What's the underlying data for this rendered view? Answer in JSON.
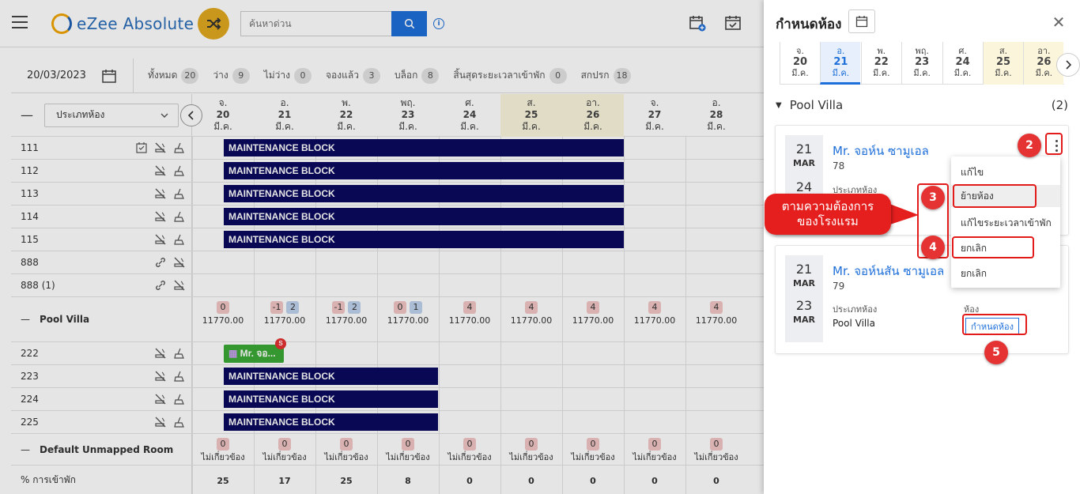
{
  "header": {
    "app_name": "eZee Absolute",
    "search_placeholder": "ค้นหาด่วน",
    "info_label": "i"
  },
  "toolbar": {
    "date": "20/03/2023",
    "stats": [
      {
        "label": "ทั้งหมด",
        "count": "20"
      },
      {
        "label": "ว่าง",
        "count": "9"
      },
      {
        "label": "ไม่ว่าง",
        "count": "0"
      },
      {
        "label": "จองแล้ว",
        "count": "3"
      },
      {
        "label": "บล็อก",
        "count": "8"
      },
      {
        "label": "สิ้นสุดระยะเวลาเข้าพัก",
        "count": "0"
      },
      {
        "label": "สกปรก",
        "count": "18"
      }
    ]
  },
  "grid": {
    "room_type_select": "ประเภทห้อง",
    "days": [
      {
        "dow": "จ.",
        "day": "20",
        "mon": "มี.ค."
      },
      {
        "dow": "อ.",
        "day": "21",
        "mon": "มี.ค."
      },
      {
        "dow": "พ.",
        "day": "22",
        "mon": "มี.ค."
      },
      {
        "dow": "พฤ.",
        "day": "23",
        "mon": "มี.ค."
      },
      {
        "dow": "ศ.",
        "day": "24",
        "mon": "มี.ค."
      },
      {
        "dow": "ส.",
        "day": "25",
        "mon": "มี.ค."
      },
      {
        "dow": "อา.",
        "day": "26",
        "mon": "มี.ค."
      },
      {
        "dow": "จ.",
        "day": "27",
        "mon": "มี.ค."
      },
      {
        "dow": "อ.",
        "day": "28",
        "mon": "มี.ค."
      }
    ],
    "rooms_top": [
      "111",
      "112",
      "113",
      "114",
      "115",
      "888",
      "888 (1)"
    ],
    "block_label": "MAINTENANCE BLOCK",
    "pool_villa": {
      "name": "Pool Villa",
      "avail": [
        [
          "0"
        ],
        [
          "-1",
          "2"
        ],
        [
          "-1",
          "2"
        ],
        [
          "0",
          "1"
        ],
        [
          "4"
        ],
        [
          "4"
        ],
        [
          "4"
        ],
        [
          "4"
        ],
        [
          "4"
        ]
      ],
      "price": "11770.00"
    },
    "rooms_pool": [
      "222",
      "223",
      "224",
      "225"
    ],
    "booking_chip": "Mr. จอ...",
    "booking_badge": "S",
    "unmapped": {
      "name": "Default Unmapped Room",
      "value": "0",
      "text": "ไม่เกี่ยวข้อง"
    },
    "occupancy": {
      "label": "% การเข้าพัก",
      "values": [
        "25",
        "17",
        "25",
        "8",
        "0",
        "0",
        "0",
        "0",
        "0"
      ]
    }
  },
  "panel": {
    "title": "กำหนดห้อง",
    "dates": [
      {
        "dow": "จ.",
        "day": "20",
        "mon": "มี.ค."
      },
      {
        "dow": "อ.",
        "day": "21",
        "mon": "มี.ค."
      },
      {
        "dow": "พ.",
        "day": "22",
        "mon": "มี.ค."
      },
      {
        "dow": "พฤ.",
        "day": "23",
        "mon": "มี.ค."
      },
      {
        "dow": "ศ.",
        "day": "24",
        "mon": "มี.ค."
      },
      {
        "dow": "ส.",
        "day": "25",
        "mon": "มี.ค."
      },
      {
        "dow": "อา.",
        "day": "26",
        "mon": "มี.ค."
      }
    ],
    "section": "Pool Villa",
    "section_count": "(2)",
    "card1": {
      "day": "21",
      "mon": "MAR",
      "name": "Mr. จอห์น ซามูเอล",
      "num": "78",
      "type_label": "ประเภทห้อง",
      "day2": "24"
    },
    "card2": {
      "day": "21",
      "mon": "MAR",
      "day2": "23",
      "mon2": "MAR",
      "name": "Mr. จอห์นสัน ซามูเอล",
      "num": "79",
      "type_label": "ประเภทห้อง",
      "type_val": "Pool Villa",
      "room_label": "ห้อง",
      "assign_btn": "กำหนดห้อง"
    },
    "menu": [
      "แก้ไข",
      "ย้ายห้อง",
      "แก้ไขระยะเวลาเข้าพัก",
      "ยกเลิก",
      "ยกเลิก"
    ]
  },
  "annotations": {
    "n2": "2",
    "n3": "3",
    "n4": "4",
    "n5": "5",
    "callout": "ตามความต้องการ\nของโรงแรม"
  }
}
